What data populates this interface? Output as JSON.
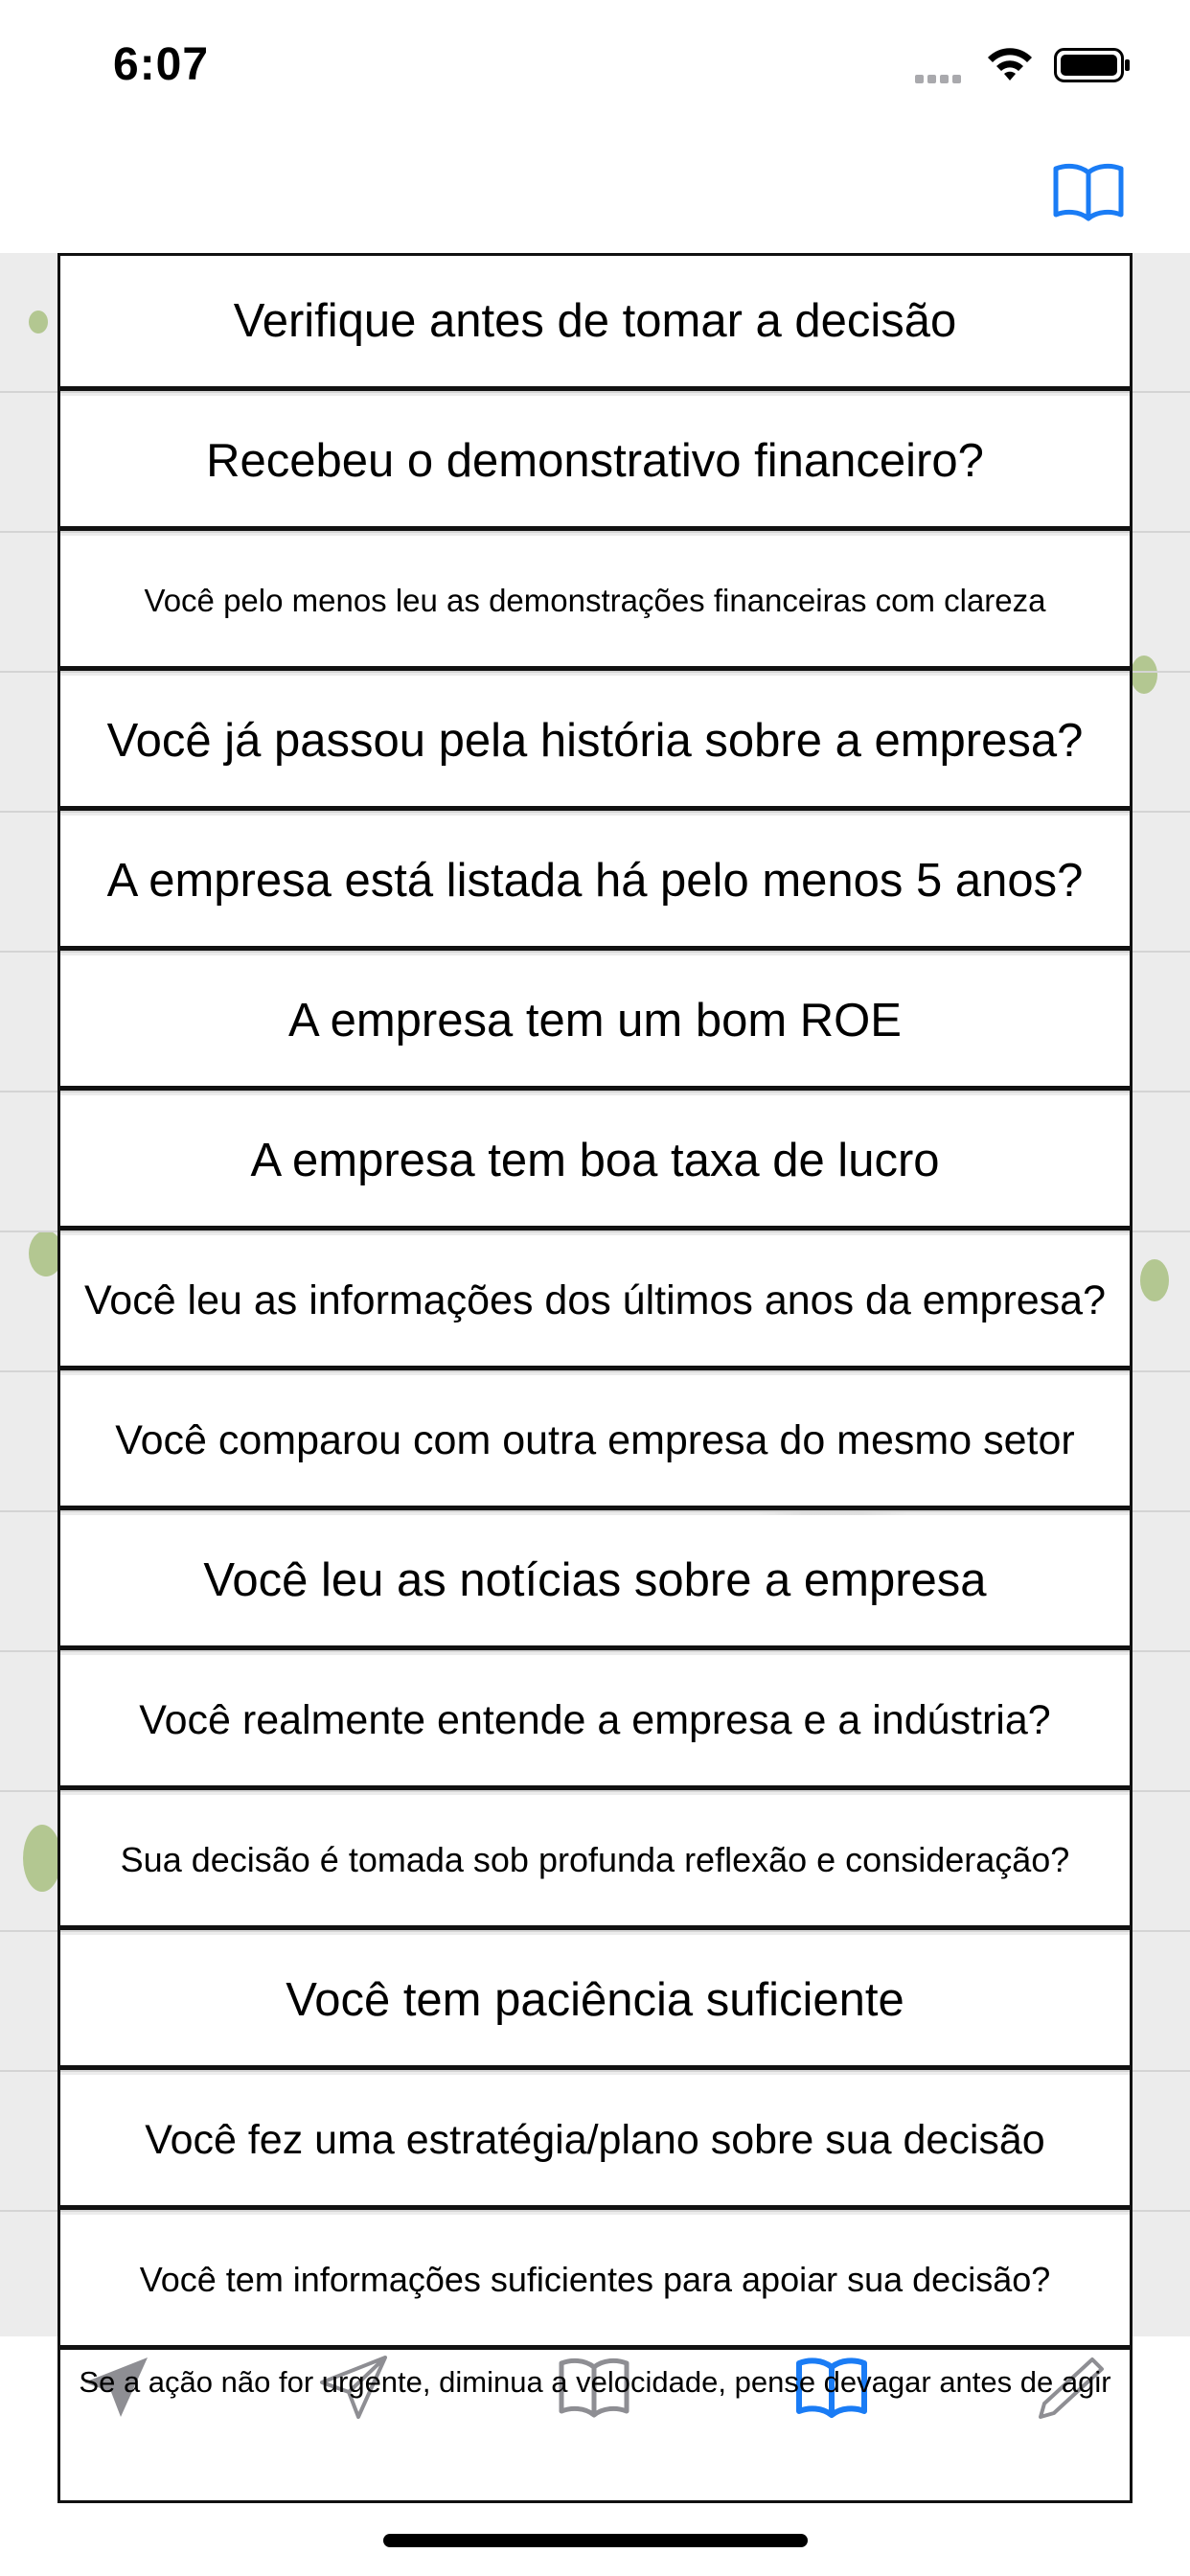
{
  "status_bar": {
    "time": "6:07",
    "icons": [
      "signal-icon",
      "wifi-icon",
      "battery-icon"
    ]
  },
  "nav": {
    "right_icon": "book-icon",
    "accent": "#1a7cf5"
  },
  "checklist": [
    "Verifique antes de tomar a decisão",
    "Recebeu o demonstrativo financeiro?",
    "Você pelo menos leu as demonstrações financeiras com clareza",
    "Você já passou pela história sobre a empresa?",
    "A empresa está listada há pelo menos 5 anos?",
    "A empresa tem um bom ROE",
    "A empresa tem boa taxa de lucro",
    "Você leu as informações dos últimos anos da empresa?",
    "Você comparou com outra empresa do mesmo setor",
    "Você leu as notícias sobre a empresa",
    "Você realmente entende a empresa e a indústria?",
    "Sua decisão é tomada sob profunda reflexão e consideração?",
    "Você tem paciência suficiente",
    "Você fez uma estratégia/plano sobre sua decisão",
    "Você tem informações suficientes para apoiar sua decisão?"
  ],
  "footer": "Se a ação não for urgente, diminua a velocidade, pense devagar antes de agir",
  "tab_bar": {
    "tabs": [
      {
        "icon": "paper-plane-filled-icon",
        "active": false
      },
      {
        "icon": "paper-plane-outline-icon",
        "active": false
      },
      {
        "icon": "book-outline-icon",
        "active": false
      },
      {
        "icon": "book-icon",
        "active": true
      },
      {
        "icon": "pencil-icon",
        "active": false
      }
    ],
    "active_color": "#1a7cf5",
    "inactive_color": "#8e8e93"
  }
}
